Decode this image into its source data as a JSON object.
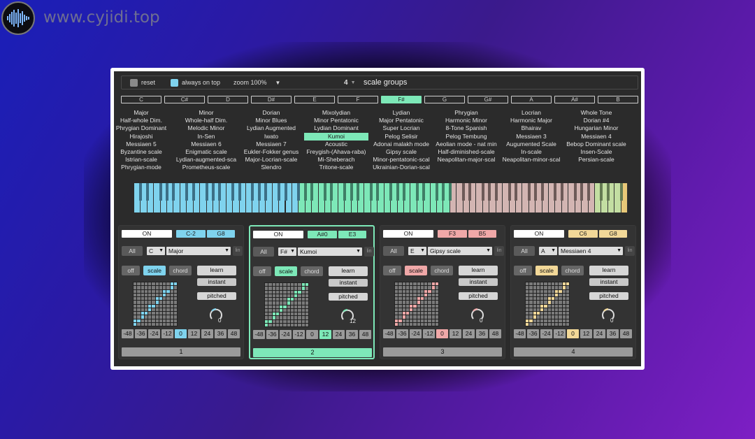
{
  "watermark": {
    "site": "www.cyjidi.top",
    "logo_icon": "waveform-icon"
  },
  "topbar": {
    "reset_label": "reset",
    "always_on_top_label": "always on top",
    "zoom_label": "zoom 100%",
    "group_count": "4",
    "scale_groups_label": "scale groups"
  },
  "notes": [
    "C",
    "C#",
    "D",
    "D#",
    "E",
    "F",
    "F#",
    "G",
    "G#",
    "A",
    "A#",
    "B"
  ],
  "selected_note": "F#",
  "scale_columns": [
    [
      "Major",
      "Half-whole Dim.",
      "Phrygian Dominant",
      "Hirajoshi",
      "Messiaen 5",
      "Byzantine scale",
      "Istrian-scale",
      "Phrygian-mode"
    ],
    [
      "Minor",
      "Whole-half Dim.",
      "Melodic Minor",
      "In-Sen",
      "Messiaen 6",
      "Enigmatic scale",
      "Lydian-augmented-sca",
      "Prometheus-scale"
    ],
    [
      "Dorian",
      "Minor Blues",
      "Lydian Augmented",
      "Iwato",
      "Messiaen 7",
      "Eukler-Fokker genus",
      "Major-Locrian-scale",
      "Slendro"
    ],
    [
      "Mixolydian",
      "Minor Pentatonic",
      "Lydian Dominant",
      "Kumoi",
      "Acoustic",
      "Freygish-(Ahava-raba)",
      "Mi-Sheberach",
      "Tritone-scale"
    ],
    [
      "Lydian",
      "Major Pentatonic",
      "Super Locrian",
      "Pelog Selisir",
      "Adonai malakh mode",
      "Gipsy scale",
      "Minor-pentatonic-scal",
      "Ukrainian-Dorian-scal"
    ],
    [
      "Phrygian",
      "Harmonic Minor",
      "8-Tone Spanish",
      "Pelog Tembung",
      "Aeolian mode - nat min",
      "Half-diminished-scale",
      "Neapolitan-major-scal",
      ""
    ],
    [
      "Locrian",
      "Harmonic Major",
      "Bhairav",
      "Messiaen 3",
      "Augumented Scale",
      "In-scale",
      "Neapolitan-minor-scal",
      ""
    ],
    [
      "Whole Tone",
      "Dorian #4",
      "Hungarian Minor",
      "Messiaen 4",
      "Bebop Dominant scale",
      "Insen-Scale",
      "Persian-scale",
      ""
    ]
  ],
  "selected_scale": "Kumoi",
  "keyboard_zones": [
    {
      "name": "zone-1",
      "color": "#7fd3ee"
    },
    {
      "name": "zone-2",
      "color": "#7de8b8"
    },
    {
      "name": "zone-3",
      "color": "#d3b5b2"
    },
    {
      "name": "zone-4",
      "color": "#c3dea2"
    }
  ],
  "panels": [
    {
      "id": "1",
      "on": "ON",
      "low": "C-2",
      "high": "G8",
      "color": "#7fd3ee",
      "all": "All",
      "root": "C",
      "scale": "Major",
      "lin": "lin",
      "off": "off",
      "scale_btn": "scale",
      "chord": "chord",
      "learn": "learn",
      "instant": "instant",
      "pitched": "pitched",
      "knob_value": "0",
      "transpose": [
        "-48",
        "-36",
        "-24",
        "-12",
        "0",
        "12",
        "24",
        "36",
        "48"
      ],
      "transpose_selected": "0",
      "active": false
    },
    {
      "id": "2",
      "on": "ON",
      "low": "A#0",
      "high": "E3",
      "color": "#7de8b8",
      "all": "All",
      "root": "F#",
      "scale": "Kumoi",
      "lin": "lin",
      "off": "off",
      "scale_btn": "scale",
      "chord": "chord",
      "learn": "learn",
      "instant": "instant",
      "pitched": "pitched",
      "knob_value": "12",
      "transpose": [
        "-48",
        "-36",
        "-24",
        "-12",
        "0",
        "12",
        "24",
        "36",
        "48"
      ],
      "transpose_selected": "12",
      "active": true
    },
    {
      "id": "3",
      "on": "ON",
      "low": "F3",
      "high": "B5",
      "color": "#f0a8a8",
      "all": "All",
      "root": "E",
      "scale": "Gipsy scale",
      "lin": "lin",
      "off": "off",
      "scale_btn": "scale",
      "chord": "chord",
      "learn": "learn",
      "instant": "instant",
      "pitched": "pitched",
      "knob_value": "0",
      "transpose": [
        "-48",
        "-36",
        "-24",
        "-12",
        "0",
        "12",
        "24",
        "36",
        "48"
      ],
      "transpose_selected": "0",
      "active": false
    },
    {
      "id": "4",
      "on": "ON",
      "low": "C6",
      "high": "G8",
      "color": "#f2d898",
      "all": "All",
      "root": "A",
      "scale": "Messiaen 4",
      "lin": "lin",
      "off": "off",
      "scale_btn": "scale",
      "chord": "chord",
      "learn": "learn",
      "instant": "instant",
      "pitched": "pitched",
      "knob_value": "0",
      "transpose": [
        "-48",
        "-36",
        "-24",
        "-12",
        "0",
        "12",
        "24",
        "36",
        "48"
      ],
      "transpose_selected": "0",
      "active": false
    }
  ]
}
